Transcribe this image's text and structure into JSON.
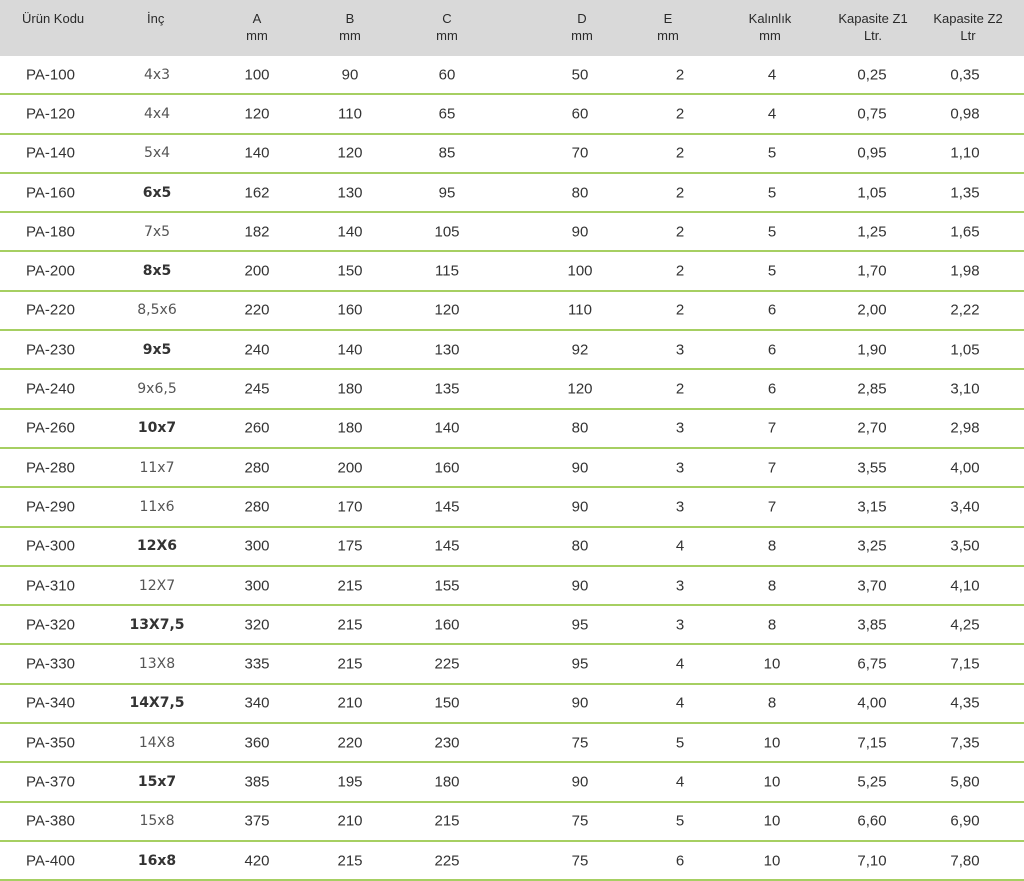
{
  "header": {
    "code": "Ürün Kodu",
    "inch": "İnç",
    "a": "A",
    "a_unit": "mm",
    "b": "B",
    "b_unit": "mm",
    "c": "C",
    "c_unit": "mm",
    "d": "D",
    "d_unit": "mm",
    "e": "E",
    "e_unit": "mm",
    "thickness": "Kalınlık",
    "thickness_unit": "mm",
    "z1": "Kapasite Z1",
    "z1_unit": "Ltr.",
    "z2": "Kapasite Z2",
    "z2_unit": "Ltr"
  },
  "rows": [
    {
      "code": "PA-100",
      "inch": "4x3",
      "inch_bold": false,
      "a": "100",
      "b": "90",
      "c": "60",
      "d": "50",
      "e": "2",
      "k": "4",
      "z1": "0,25",
      "z2": "0,35"
    },
    {
      "code": "PA-120",
      "inch": "4x4",
      "inch_bold": false,
      "a": "120",
      "b": "110",
      "c": "65",
      "d": "60",
      "e": "2",
      "k": "4",
      "z1": "0,75",
      "z2": "0,98"
    },
    {
      "code": "PA-140",
      "inch": "5x4",
      "inch_bold": false,
      "a": "140",
      "b": "120",
      "c": "85",
      "d": "70",
      "e": "2",
      "k": "5",
      "z1": "0,95",
      "z2": "1,10"
    },
    {
      "code": "PA-160",
      "inch": "6x5",
      "inch_bold": true,
      "a": "162",
      "b": "130",
      "c": "95",
      "d": "80",
      "e": "2",
      "k": "5",
      "z1": "1,05",
      "z2": "1,35"
    },
    {
      "code": "PA-180",
      "inch": "7x5",
      "inch_bold": false,
      "a": "182",
      "b": "140",
      "c": "105",
      "d": "90",
      "e": "2",
      "k": "5",
      "z1": "1,25",
      "z2": "1,65"
    },
    {
      "code": "PA-200",
      "inch": "8x5",
      "inch_bold": true,
      "a": "200",
      "b": "150",
      "c": "115",
      "d": "100",
      "e": "2",
      "k": "5",
      "z1": "1,70",
      "z2": "1,98"
    },
    {
      "code": "PA-220",
      "inch": "8,5x6",
      "inch_bold": false,
      "a": "220",
      "b": "160",
      "c": "120",
      "d": "110",
      "e": "2",
      "k": "6",
      "z1": "2,00",
      "z2": "2,22"
    },
    {
      "code": "PA-230",
      "inch": "9x5",
      "inch_bold": true,
      "a": "240",
      "b": "140",
      "c": "130",
      "d": "92",
      "e": "3",
      "k": "6",
      "z1": "1,90",
      "z2": "1,05"
    },
    {
      "code": "PA-240",
      "inch": "9x6,5",
      "inch_bold": false,
      "a": "245",
      "b": "180",
      "c": "135",
      "d": "120",
      "e": "2",
      "k": "6",
      "z1": "2,85",
      "z2": "3,10"
    },
    {
      "code": "PA-260",
      "inch": "10x7",
      "inch_bold": true,
      "a": "260",
      "b": "180",
      "c": "140",
      "d": "80",
      "e": "3",
      "k": "7",
      "z1": "2,70",
      "z2": "2,98"
    },
    {
      "code": "PA-280",
      "inch": "11x7",
      "inch_bold": false,
      "a": "280",
      "b": "200",
      "c": "160",
      "d": "90",
      "e": "3",
      "k": "7",
      "z1": "3,55",
      "z2": "4,00"
    },
    {
      "code": "PA-290",
      "inch": "11x6",
      "inch_bold": false,
      "a": "280",
      "b": "170",
      "c": "145",
      "d": "90",
      "e": "3",
      "k": "7",
      "z1": "3,15",
      "z2": "3,40"
    },
    {
      "code": "PA-300",
      "inch": "12X6",
      "inch_bold": true,
      "a": "300",
      "b": "175",
      "c": "145",
      "d": "80",
      "e": "4",
      "k": "8",
      "z1": "3,25",
      "z2": "3,50"
    },
    {
      "code": "PA-310",
      "inch": "12X7",
      "inch_bold": false,
      "a": "300",
      "b": "215",
      "c": "155",
      "d": "90",
      "e": "3",
      "k": "8",
      "z1": "3,70",
      "z2": "4,10"
    },
    {
      "code": "PA-320",
      "inch": "13X7,5",
      "inch_bold": true,
      "a": "320",
      "b": "215",
      "c": "160",
      "d": "95",
      "e": "3",
      "k": "8",
      "z1": "3,85",
      "z2": "4,25"
    },
    {
      "code": "PA-330",
      "inch": "13X8",
      "inch_bold": false,
      "a": "335",
      "b": "215",
      "c": "225",
      "d": "95",
      "e": "4",
      "k": "10",
      "z1": "6,75",
      "z2": "7,15"
    },
    {
      "code": "PA-340",
      "inch": "14X7,5",
      "inch_bold": true,
      "a": "340",
      "b": "210",
      "c": "150",
      "d": "90",
      "e": "4",
      "k": "8",
      "z1": "4,00",
      "z2": "4,35"
    },
    {
      "code": "PA-350",
      "inch": "14X8",
      "inch_bold": false,
      "a": "360",
      "b": "220",
      "c": "230",
      "d": "75",
      "e": "5",
      "k": "10",
      "z1": "7,15",
      "z2": "7,35"
    },
    {
      "code": "PA-370",
      "inch": "15x7",
      "inch_bold": true,
      "a": "385",
      "b": "195",
      "c": "180",
      "d": "90",
      "e": "4",
      "k": "10",
      "z1": "5,25",
      "z2": "5,80"
    },
    {
      "code": "PA-380",
      "inch": "15x8",
      "inch_bold": false,
      "a": "375",
      "b": "210",
      "c": "215",
      "d": "75",
      "e": "5",
      "k": "10",
      "z1": "6,60",
      "z2": "6,90"
    },
    {
      "code": "PA-400",
      "inch": "16x8",
      "inch_bold": true,
      "a": "420",
      "b": "215",
      "c": "225",
      "d": "75",
      "e": "6",
      "k": "10",
      "z1": "7,10",
      "z2": "7,80"
    }
  ],
  "colors": {
    "header_bg": "#d9d9d9",
    "row_divider": "#a6cf62"
  }
}
